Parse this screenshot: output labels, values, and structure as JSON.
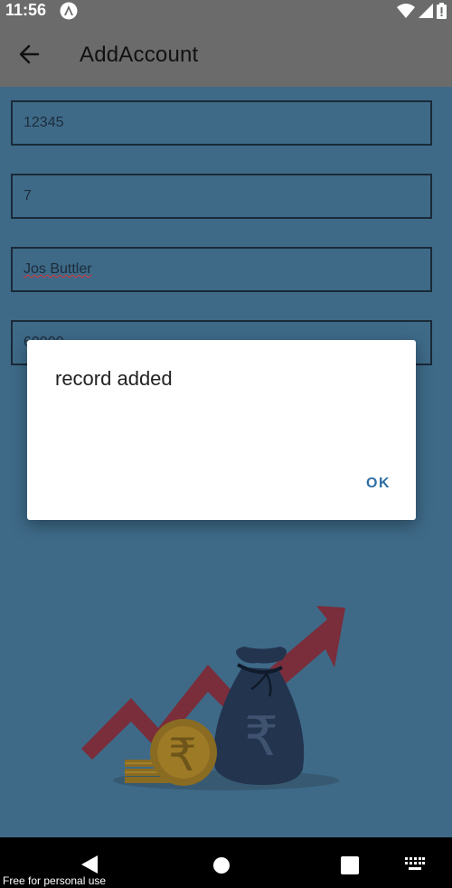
{
  "status_bar": {
    "time": "11:56"
  },
  "app_bar": {
    "title": "AddAccount"
  },
  "form": {
    "fields": [
      {
        "value": "12345"
      },
      {
        "value": "7"
      },
      {
        "value": "Jos Buttler"
      },
      {
        "value": "60000"
      }
    ]
  },
  "dialog": {
    "message": "record added",
    "ok_label": "OK"
  },
  "watermark": "Free for personal use",
  "icons": {
    "back": "arrow-left-icon",
    "app": "app-logo-icon",
    "wifi": "wifi-icon",
    "signal": "signal-icon",
    "battery": "battery-icon",
    "illustration": "money-growth-illustration"
  },
  "colors": {
    "background": "#3e6a88",
    "bars": "#6b6b6b",
    "accent": "#2f6ea5"
  }
}
